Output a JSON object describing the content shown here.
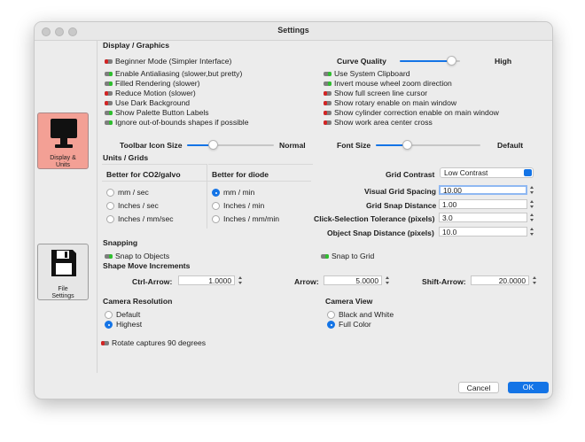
{
  "window": {
    "title": "Settings"
  },
  "sidebar": {
    "display": {
      "label_line1": "Display &",
      "label_line2": "Units"
    },
    "file": {
      "label_line1": "File",
      "label_line2": "Settings"
    }
  },
  "display": {
    "heading": "Display / Graphics",
    "left_options": [
      {
        "label": "Beginner Mode (Simpler Interface)",
        "on": false
      },
      {
        "label": "Enable Antialiasing (slower,but pretty)",
        "on": true
      },
      {
        "label": "Filled Rendering (slower)",
        "on": true
      },
      {
        "label": "Reduce Motion (slower)",
        "on": false
      },
      {
        "label": "Use Dark Background",
        "on": false
      },
      {
        "label": "Show Palette Button Labels",
        "on": true
      },
      {
        "label": "Ignore out-of-bounds shapes if possible",
        "on": true
      }
    ],
    "right_options": [
      {
        "label": "Use System Clipboard",
        "on": true
      },
      {
        "label": "Invert mouse wheel zoom direction",
        "on": true
      },
      {
        "label": "Show full screen line cursor",
        "on": false
      },
      {
        "label": "Show rotary enable on main window",
        "on": false
      },
      {
        "label": "Show cylinder correction enable on main window",
        "on": false
      },
      {
        "label": "Show work area center cross",
        "on": false
      }
    ],
    "curve_quality": {
      "label": "Curve Quality",
      "value_label": "High",
      "level": 0.85
    },
    "toolbar_icon_size": {
      "label": "Toolbar Icon Size",
      "value_label": "Normal",
      "level": 0.3
    },
    "font_size": {
      "label": "Font Size",
      "value_label": "Default",
      "level": 0.3
    }
  },
  "units": {
    "heading": "Units / Grids",
    "co2": {
      "heading": "Better for CO2/galvo",
      "options": [
        "mm / sec",
        "Inches / sec",
        "Inches / mm/sec"
      ],
      "selected": -1
    },
    "diode": {
      "heading": "Better for diode",
      "options": [
        "mm / min",
        "Inches / min",
        "Inches / mm/min"
      ],
      "selected": 0
    },
    "grid_contrast": {
      "label": "Grid Contrast",
      "value": "Low Contrast"
    },
    "fields": [
      {
        "label": "Visual Grid Spacing",
        "value": "10.00"
      },
      {
        "label": "Grid Snap Distance",
        "value": "1.00"
      },
      {
        "label": "Click-Selection Tolerance (pixels)",
        "value": "3.0"
      },
      {
        "label": "Object Snap Distance (pixels)",
        "value": "10.0"
      }
    ]
  },
  "snapping": {
    "heading": "Snapping",
    "snap_objects": {
      "label": "Snap to Objects",
      "on": true
    },
    "snap_grid": {
      "label": "Snap to Grid",
      "on": true
    },
    "increments_heading": "Shape Move Increments",
    "ctrl_arrow": {
      "label": "Ctrl-Arrow:",
      "value": "1.0000"
    },
    "arrow": {
      "label": "Arrow:",
      "value": "5.0000"
    },
    "shift_arrow": {
      "label": "Shift-Arrow:",
      "value": "20.0000"
    }
  },
  "camera": {
    "resolution": {
      "heading": "Camera Resolution",
      "options": [
        "Default",
        "Highest"
      ],
      "selected": 1
    },
    "view": {
      "heading": "Camera View",
      "options": [
        "Black and White",
        "Full Color"
      ],
      "selected": 1
    },
    "rotate": {
      "label": "Rotate captures 90 degrees",
      "on": false
    }
  },
  "footer": {
    "cancel": "Cancel",
    "ok": "OK"
  },
  "colors": {
    "accent": "#1474e6",
    "toggle_on": "#2ec02e",
    "toggle_off": "#d42424",
    "selected_tab": "#f5a49a"
  }
}
